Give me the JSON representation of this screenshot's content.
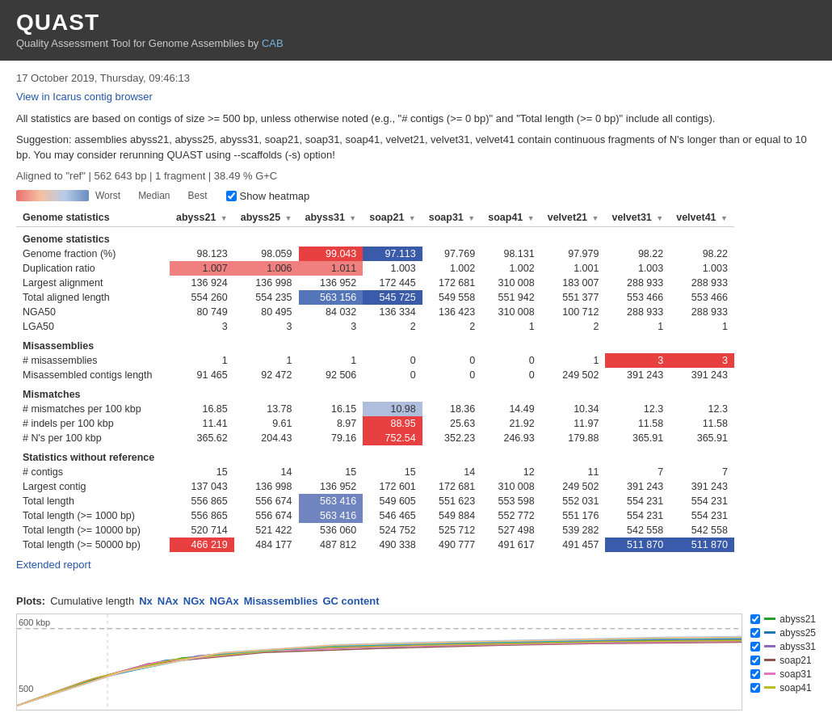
{
  "header": {
    "title": "QUAST",
    "subtitle": "Quality Assessment Tool for Genome Assemblies",
    "by_text": "by",
    "cab_link": "CAB"
  },
  "date": "17 October 2019, Thursday, 09:46:13",
  "icarus_link": "View in Icarus contig browser",
  "info1": "All statistics are based on contigs of size >= 500 bp, unless otherwise noted (e.g., \"# contigs (>= 0 bp)\" and \"Total length (>= 0 bp)\" include all contigs).",
  "info2": "Suggestion: assemblies abyss21, abyss25, abyss31, soap21, soap31, soap41, velvet21, velvet31, velvet41 contain continuous fragments of N's longer than or equal to 10 bp. You may consider rerunning QUAST using --scaffolds (-s) option!",
  "aligned": "Aligned to \"ref\" | 562 643 bp | 1 fragment | 38.49 % G+C",
  "heatmap": {
    "worst": "Worst",
    "median": "Median",
    "best": "Best",
    "checkbox_label": "Show heatmap"
  },
  "table": {
    "columns": [
      "Genome statistics",
      "abyss21",
      "abyss25",
      "abyss31",
      "soap21",
      "soap31",
      "soap41",
      "velvet21",
      "velvet31",
      "velvet41"
    ],
    "rows": [
      {
        "section": "Genome statistics",
        "is_header": true
      },
      {
        "name": "Genome fraction (%)",
        "values": [
          "98.123",
          "98.059",
          "99.043",
          "97.113",
          "97.769",
          "98.131",
          "97.979",
          "98.22",
          "98.22"
        ],
        "colors": [
          "",
          "",
          "red-dark",
          "blue-dark",
          "",
          "",
          "",
          "",
          ""
        ]
      },
      {
        "name": "Duplication ratio",
        "values": [
          "1.007",
          "1.006",
          "1.011",
          "1.003",
          "1.002",
          "1.002",
          "1.001",
          "1.003",
          "1.003"
        ],
        "colors": [
          "red-light",
          "red-light",
          "red-light",
          "",
          "",
          "",
          "",
          "",
          ""
        ]
      },
      {
        "name": "Largest alignment",
        "values": [
          "136 924",
          "136 998",
          "136 952",
          "172 445",
          "172 681",
          "310 008",
          "183 007",
          "288 933",
          "288 933"
        ],
        "colors": [
          "",
          "",
          "",
          "",
          "",
          "",
          "",
          "",
          ""
        ]
      },
      {
        "name": "Total aligned length",
        "values": [
          "554 260",
          "554 235",
          "563 156",
          "545 725",
          "549 558",
          "551 942",
          "551 377",
          "553 466",
          "553 466"
        ],
        "colors": [
          "",
          "",
          "blue-med",
          "blue-dark",
          "",
          "",
          "",
          "",
          ""
        ]
      },
      {
        "name": "NGA50",
        "values": [
          "80 749",
          "80 495",
          "84 032",
          "136 334",
          "136 423",
          "310 008",
          "100 712",
          "288 933",
          "288 933"
        ],
        "colors": [
          "",
          "",
          "",
          "",
          "",
          "",
          "",
          "",
          ""
        ]
      },
      {
        "name": "LGA50",
        "values": [
          "3",
          "3",
          "3",
          "2",
          "2",
          "1",
          "2",
          "1",
          "1"
        ],
        "colors": [
          "",
          "",
          "",
          "",
          "",
          "",
          "",
          "",
          ""
        ]
      },
      {
        "section": "Misassemblies",
        "is_header": true
      },
      {
        "name": "# misassemblies",
        "values": [
          "1",
          "1",
          "1",
          "0",
          "0",
          "0",
          "1",
          "3",
          "3"
        ],
        "colors": [
          "",
          "",
          "",
          "",
          "",
          "",
          "",
          "red-dark",
          "red-dark"
        ]
      },
      {
        "name": "Misassembled contigs length",
        "values": [
          "91 465",
          "92 472",
          "92 506",
          "0",
          "0",
          "0",
          "249 502",
          "391 243",
          "391 243"
        ],
        "colors": [
          "",
          "",
          "",
          "",
          "",
          "",
          "",
          "",
          ""
        ]
      },
      {
        "section": "Mismatches",
        "is_header": true
      },
      {
        "name": "# mismatches per 100 kbp",
        "values": [
          "16.85",
          "13.78",
          "16.15",
          "10.98",
          "18.36",
          "14.49",
          "10.34",
          "12.3",
          "12.3"
        ],
        "colors": [
          "",
          "",
          "",
          "blue-pale",
          "",
          "",
          "",
          "",
          ""
        ]
      },
      {
        "name": "# indels per 100 kbp",
        "values": [
          "11.41",
          "9.61",
          "8.97",
          "88.95",
          "25.63",
          "21.92",
          "11.97",
          "11.58",
          "11.58"
        ],
        "colors": [
          "",
          "",
          "",
          "red-dark",
          "",
          "",
          "",
          "",
          ""
        ]
      },
      {
        "name": "# N's per 100 kbp",
        "values": [
          "365.62",
          "204.43",
          "79.16",
          "752.54",
          "352.23",
          "246.93",
          "179.88",
          "365.91",
          "365.91"
        ],
        "colors": [
          "",
          "",
          "",
          "red-dark",
          "",
          "",
          "",
          "",
          ""
        ]
      },
      {
        "section": "Statistics without reference",
        "is_header": true
      },
      {
        "name": "# contigs",
        "values": [
          "15",
          "14",
          "15",
          "15",
          "14",
          "12",
          "11",
          "7",
          "7"
        ],
        "colors": [
          "",
          "",
          "",
          "",
          "",
          "",
          "",
          "",
          ""
        ]
      },
      {
        "name": "Largest contig",
        "values": [
          "137 043",
          "136 998",
          "136 952",
          "172 601",
          "172 681",
          "310 008",
          "249 502",
          "391 243",
          "391 243"
        ],
        "colors": [
          "",
          "",
          "",
          "",
          "",
          "",
          "",
          "",
          ""
        ]
      },
      {
        "name": "Total length",
        "values": [
          "556 865",
          "556 674",
          "563 416",
          "549 605",
          "551 623",
          "553 598",
          "552 031",
          "554 231",
          "554 231"
        ],
        "colors": [
          "",
          "",
          "blue-light",
          "",
          "",
          "",
          "",
          "",
          ""
        ]
      },
      {
        "name": "Total length (>= 1000 bp)",
        "values": [
          "556 865",
          "556 674",
          "563 416",
          "546 465",
          "549 884",
          "552 772",
          "551 176",
          "554 231",
          "554 231"
        ],
        "colors": [
          "",
          "",
          "blue-light",
          "",
          "",
          "",
          "",
          "",
          ""
        ]
      },
      {
        "name": "Total length (>= 10000 bp)",
        "values": [
          "520 714",
          "521 422",
          "536 060",
          "524 752",
          "525 712",
          "527 498",
          "539 282",
          "542 558",
          "542 558"
        ],
        "colors": [
          "",
          "",
          "",
          "",
          "",
          "",
          "",
          "",
          ""
        ]
      },
      {
        "name": "Total length (>= 50000 bp)",
        "values": [
          "466 219",
          "484 177",
          "487 812",
          "490 338",
          "490 777",
          "491 617",
          "491 457",
          "511 870",
          "511 870"
        ],
        "colors": [
          "red-dark",
          "",
          "",
          "",
          "",
          "",
          "",
          "blue-dark",
          "blue-dark"
        ]
      }
    ]
  },
  "extended_report": "Extended report",
  "plots": {
    "label": "Plots:",
    "tabs": [
      "Cumulative length",
      "Nx",
      "NAx",
      "NGx",
      "NGAx",
      "Misassemblies",
      "GC content"
    ],
    "active_tab": "Cumulative length",
    "y_label": "600 kbp",
    "y_label2": "500",
    "legend": [
      {
        "name": "abyss21",
        "color": "#2ca02c"
      },
      {
        "name": "abyss25",
        "color": "#1f77b4"
      },
      {
        "name": "abyss31",
        "color": "#9467bd"
      },
      {
        "name": "soap21",
        "color": "#8c564b"
      },
      {
        "name": "soap31",
        "color": "#e377c2"
      },
      {
        "name": "soap41",
        "color": "#bcbd22"
      }
    ]
  }
}
